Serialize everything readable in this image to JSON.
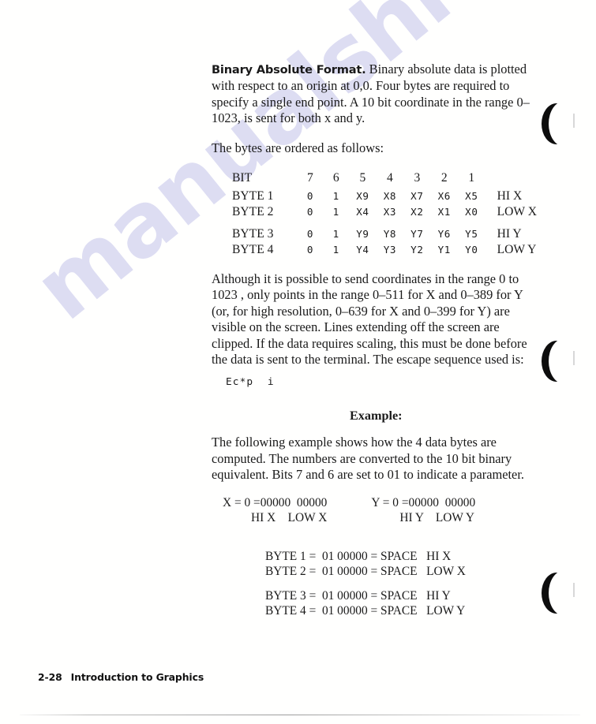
{
  "page": {
    "watermark_text": "manualshive.com",
    "watermark_color": "#c9c9ec"
  },
  "section": {
    "heading": "Binary Absolute Format.",
    "intro_paragraph": "Binary absolute data is plotted with respect to an origin at 0,0. Four bytes are required to specify a single end point. A 10 bit coordinate in the range 0–1023, is sent for both x and y.",
    "order_intro": "The bytes are ordered as follows:"
  },
  "bit_table": {
    "row_label_header": "BIT",
    "bit_headers": [
      "7",
      "6",
      "5",
      "4",
      "3",
      "2",
      "1"
    ],
    "rows": [
      {
        "label": "BYTE 1",
        "bits": [
          "0",
          "1",
          "X9",
          "X8",
          "X7",
          "X6",
          "X5"
        ],
        "tail": "HI X"
      },
      {
        "label": "BYTE 2",
        "bits": [
          "0",
          "1",
          "X4",
          "X3",
          "X2",
          "X1",
          "X0"
        ],
        "tail": "LOW X"
      },
      {
        "label": "BYTE 3",
        "bits": [
          "0",
          "1",
          "Y9",
          "Y8",
          "Y7",
          "Y6",
          "Y5"
        ],
        "tail": "HI Y"
      },
      {
        "label": "BYTE 4",
        "bits": [
          "0",
          "1",
          "Y4",
          "Y3",
          "Y2",
          "Y1",
          "Y0"
        ],
        "tail": "LOW Y"
      }
    ]
  },
  "range_paragraph": "Although it is possible to send coordinates in the range 0 to 1023 , only points in the range 0–511 for X and 0–389 for Y (or, for high resolution, 0–639 for X and 0–399 for Y) are visible on the screen. Lines extending off the screen are clipped. If the data requires scaling, this must be done before the data is sent to the terminal. The escape sequence used is:",
  "escape_sequence": "Ec*p  i",
  "example": {
    "heading": "Example:",
    "paragraph": "The following example shows how the 4 data bytes are computed. The numbers are converted to the 10 bit binary equivalent. Bits 7 and 6 are set to 01 to indicate a parameter.",
    "coordinates": [
      {
        "expression": "X = 0 =00000  00000",
        "labels": "HI X    LOW X"
      },
      {
        "expression": "Y = 0 =00000  00000",
        "labels": "HI Y    LOW Y"
      }
    ],
    "byte_lines": [
      {
        "text": "BYTE 1 =  01 00000 = SPACE",
        "tail": "HI X"
      },
      {
        "text": "BYTE 2 =  01 00000 = SPACE",
        "tail": "LOW X"
      },
      {
        "text": "BYTE 3 =  01 00000 = SPACE",
        "tail": "HI Y"
      },
      {
        "text": "BYTE 4 =  01 00000 = SPACE",
        "tail": "LOW Y"
      }
    ]
  },
  "footer": {
    "page_number": "2-28",
    "chapter_title": "Introduction to Graphics"
  }
}
